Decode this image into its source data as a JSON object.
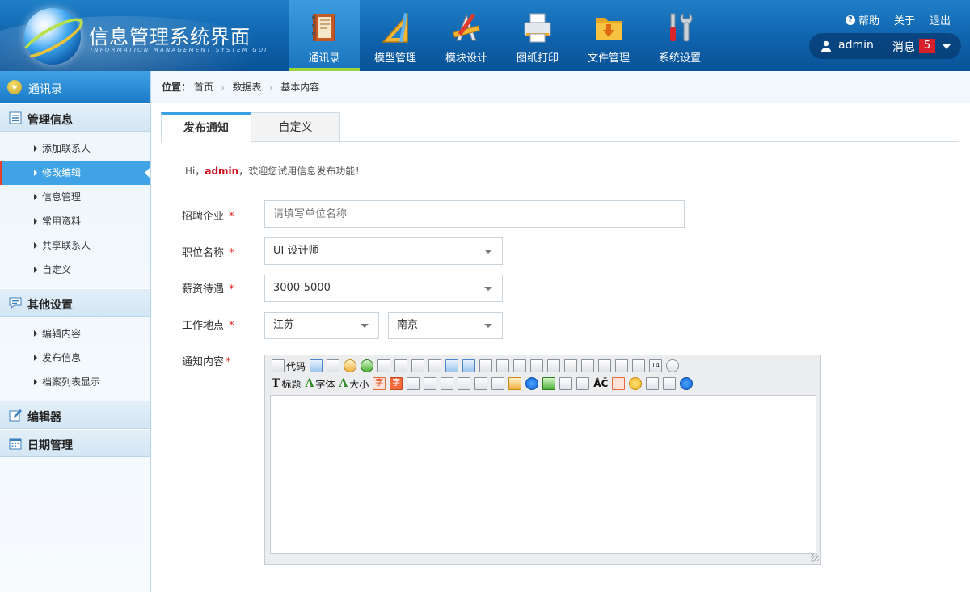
{
  "app": {
    "title": "信息管理系统界面",
    "subtitle": "INFORMATION MANAGEMENT SYSTEM GUI"
  },
  "nav": [
    {
      "label": "通讯录",
      "icon": "address-book-icon",
      "active": true
    },
    {
      "label": "模型管理",
      "icon": "triangle-ruler-icon"
    },
    {
      "label": "模块设计",
      "icon": "design-tools-icon"
    },
    {
      "label": "图纸打印",
      "icon": "printer-icon"
    },
    {
      "label": "文件管理",
      "icon": "folder-icon"
    },
    {
      "label": "系统设置",
      "icon": "tools-icon"
    }
  ],
  "header_links": {
    "help": "帮助",
    "about": "关于",
    "logout": "退出"
  },
  "user": {
    "name": "admin",
    "messages_label": "消息",
    "message_count": "5"
  },
  "sidebar": {
    "top": "通讯录",
    "groups": [
      {
        "label": "管理信息",
        "icon": "list-icon",
        "items": [
          "添加联系人",
          "修改编辑",
          "信息管理",
          "常用资料",
          "共享联系人",
          "自定义"
        ],
        "active_index": 1
      },
      {
        "label": "其他设置",
        "icon": "chat-icon",
        "items": [
          "编辑内容",
          "发布信息",
          "档案列表显示"
        ]
      },
      {
        "label": "编辑器",
        "icon": "edit-icon",
        "items": []
      },
      {
        "label": "日期管理",
        "icon": "calendar-icon",
        "items": []
      }
    ]
  },
  "breadcrumb": {
    "label": "位置：",
    "items": [
      "首页",
      "数据表",
      "基本内容"
    ]
  },
  "tabs": [
    "发布通知",
    "自定义"
  ],
  "greeting": {
    "prefix": "Hi，",
    "name": "admin",
    "suffix": "，欢迎您试用信息发布功能！"
  },
  "form": {
    "company": {
      "label": "招聘企业",
      "placeholder": "请填写单位名称"
    },
    "position": {
      "label": "职位名称",
      "value": "UI 设计师"
    },
    "salary": {
      "label": "薪资待遇",
      "value": "3000-5000"
    },
    "location": {
      "label": "工作地点",
      "province": "江苏",
      "city": "南京"
    },
    "content": {
      "label": "通知内容"
    }
  },
  "editor": {
    "code_label": "代码",
    "heading_label": "标题",
    "font_label": "字体",
    "size_label": "大小",
    "char_label": "字",
    "date_label": "14",
    "spell_label": "ÅČ"
  },
  "colors": {
    "accent": "#3a9fe5",
    "header": "#0f63ad",
    "required": "#e02020",
    "highlight_name": "#d0101b",
    "badge": "#d8202a"
  }
}
